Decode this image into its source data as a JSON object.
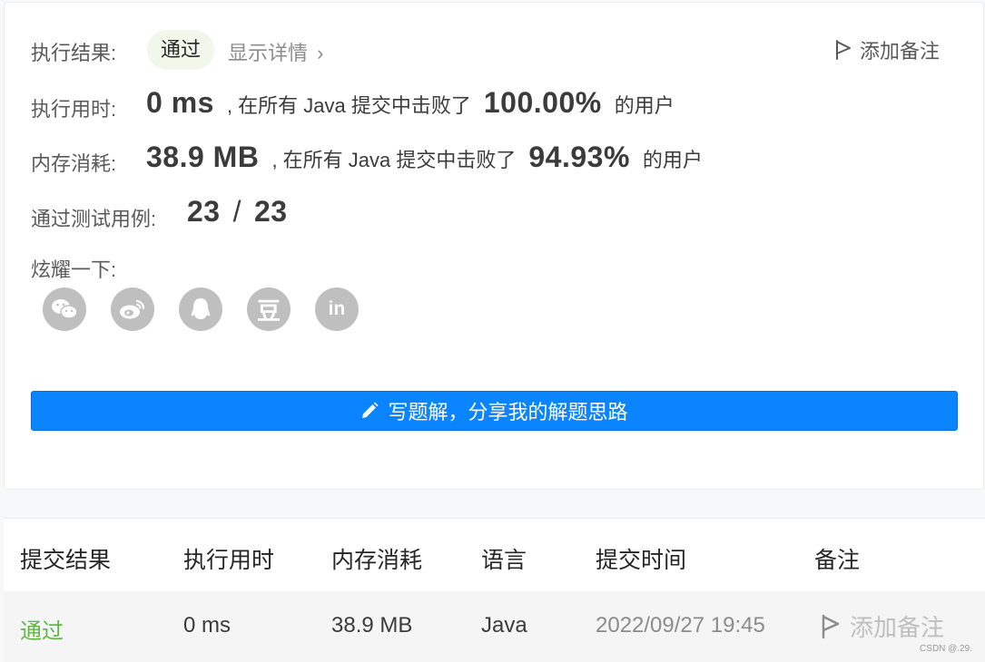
{
  "result": {
    "label": "执行结果:",
    "status": "通过",
    "details": "显示详情",
    "details_chevron": "›",
    "add_note": "添加备注"
  },
  "runtime": {
    "label": "执行用时:",
    "value": "0 ms",
    "text_before": ", 在所有 Java 提交中击败了",
    "percent": "100.00%",
    "text_after": "的用户"
  },
  "memory": {
    "label": "内存消耗:",
    "value": "38.9 MB",
    "text_before": ", 在所有 Java 提交中击败了",
    "percent": "94.93%",
    "text_after": "的用户"
  },
  "tests": {
    "label": "通过测试用例:",
    "passed": "23",
    "separator": "/",
    "total": "23"
  },
  "share": {
    "label": "炫耀一下:",
    "icons": [
      "wechat-icon",
      "weibo-icon",
      "qq-icon",
      "douban-icon",
      "linkedin-icon"
    ],
    "douban_glyph": "豆",
    "linkedin_glyph": "in"
  },
  "write_button": {
    "label": "写题解，分享我的解题思路",
    "icon": "pencil-icon"
  },
  "submissions": {
    "headers": [
      "提交结果",
      "执行用时",
      "内存消耗",
      "语言",
      "提交时间",
      "备注"
    ],
    "rows": [
      {
        "status": "通过",
        "runtime": "0 ms",
        "memory": "38.9 MB",
        "language": "Java",
        "time": "2022/09/27 19:45",
        "note": "添加备注"
      }
    ]
  },
  "watermark": "CSDN @.29.",
  "colors": {
    "accent": "#0a84ff",
    "success": "#5eb844",
    "pill_bg": "#f1f7ea",
    "icon_gray": "#bfbfbf"
  }
}
